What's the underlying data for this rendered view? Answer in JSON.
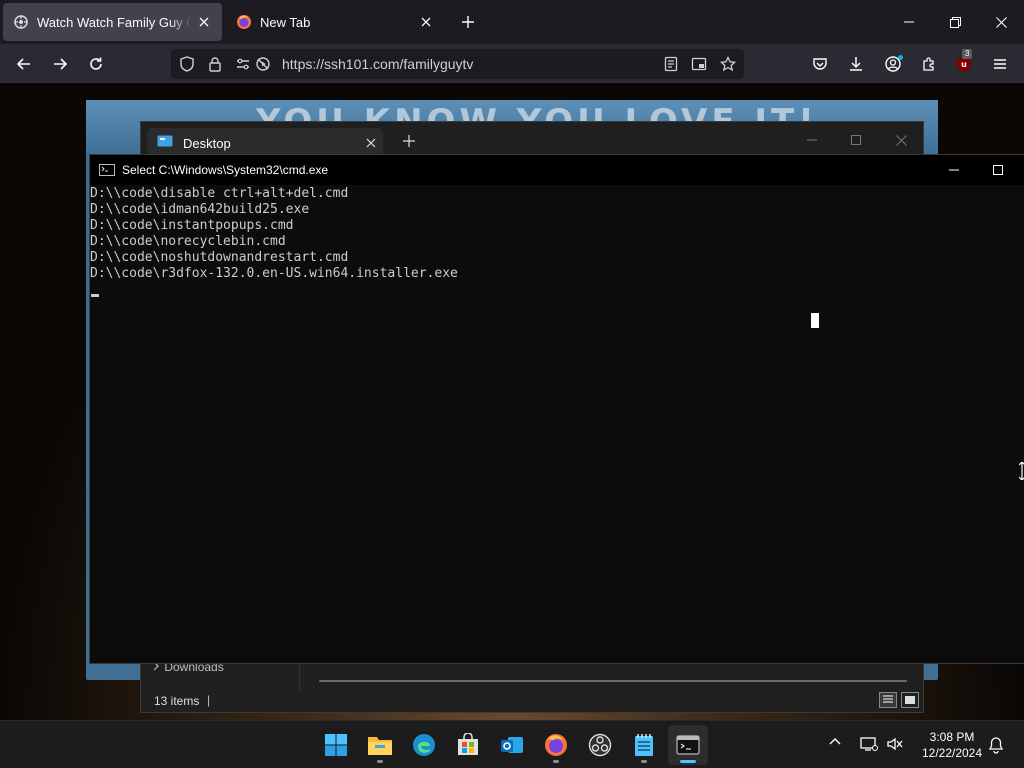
{
  "browser": {
    "tabs": [
      {
        "title": "Watch Watch Family Guy Online",
        "active": true
      },
      {
        "title": "New Tab",
        "active": false
      }
    ],
    "url": "https://ssh101.com/familyguytv",
    "extension_badge": "3"
  },
  "page": {
    "banner_text": "YOU KNOW YOU LOVE IT!"
  },
  "explorer": {
    "tab_title": "Desktop",
    "nav_item": "Downloads",
    "status_count": "13 items",
    "status_separator": "|"
  },
  "cmd": {
    "title": "Select C:\\Windows\\System32\\cmd.exe",
    "lines": [
      "D:\\\\code\\disable ctrl+alt+del.cmd",
      "D:\\\\code\\idman642build25.exe",
      "D:\\\\code\\instantpopups.cmd",
      "D:\\\\code\\norecyclebin.cmd",
      "D:\\\\code\\noshutdownandrestart.cmd",
      "D:\\\\code\\r3dfox-132.0.en-US.win64.installer.exe"
    ]
  },
  "taskbar": {
    "apps": [
      "start",
      "file-explorer",
      "edge",
      "microsoft-store",
      "outlook",
      "firefox",
      "obs-studio",
      "notepad",
      "terminal"
    ],
    "clock_time": "3:08 PM",
    "clock_date": "12/22/2024"
  },
  "colors": {
    "browser_toolbar": "#2b2a33",
    "tab_active": "#42414d",
    "taskbar_accent": "#4cc2ff",
    "console_bg": "#0c0c0c"
  }
}
